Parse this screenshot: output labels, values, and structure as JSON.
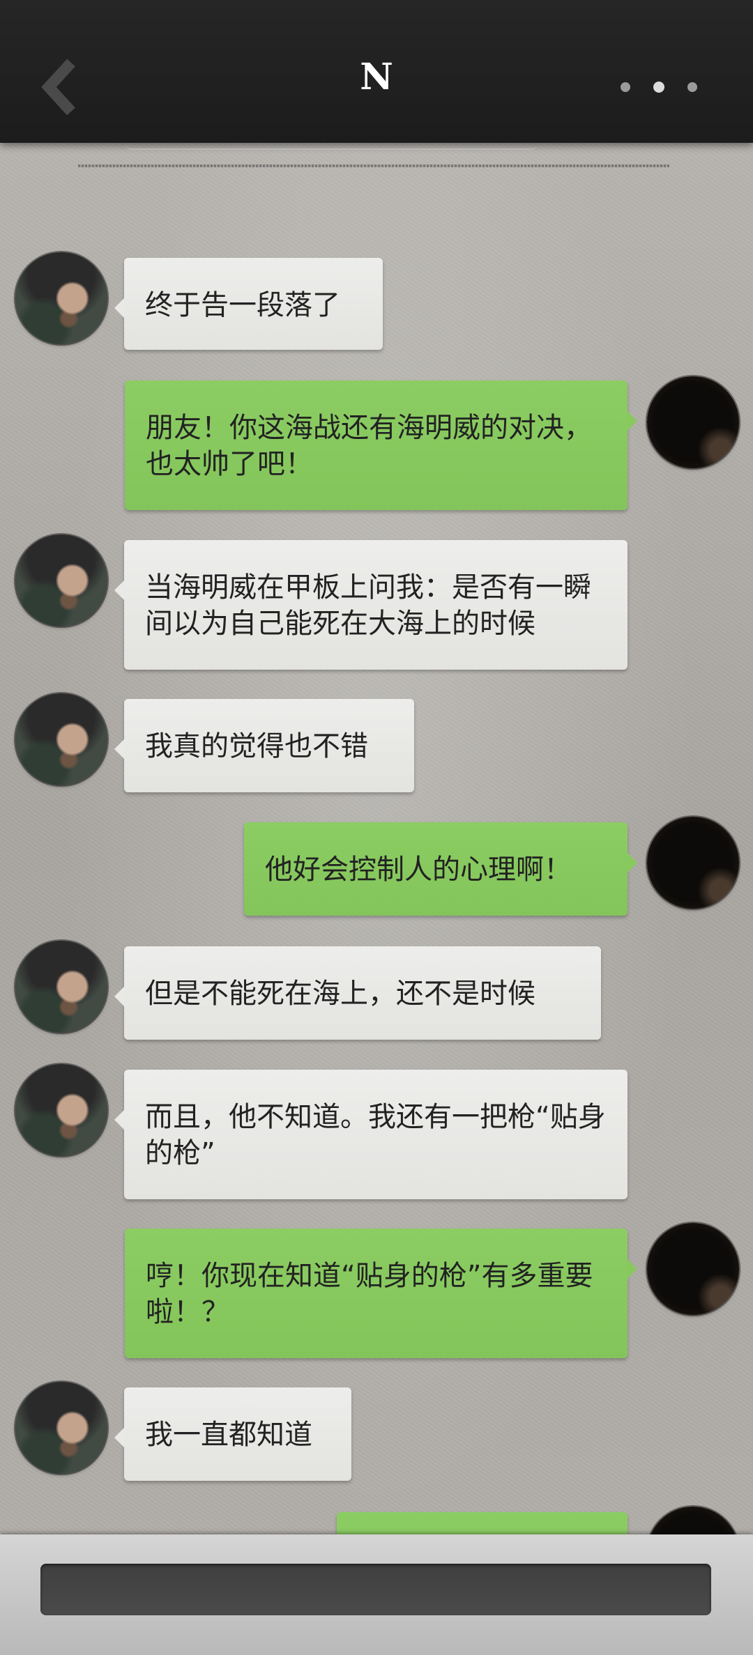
{
  "header": {
    "back_icon": "chevron-left-icon",
    "title": "N",
    "more_icon": "more-dots-icon"
  },
  "messages": [
    {
      "from": "contact",
      "text": "终于告一段落了"
    },
    {
      "from": "me",
      "text": "朋友！你这海战还有海明威的对决，也太帅了吧！"
    },
    {
      "from": "contact",
      "text": "当海明威在甲板上问我：是否有一瞬间以为自己能死在大海上的时候"
    },
    {
      "from": "contact",
      "text": "我真的觉得也不错"
    },
    {
      "from": "me",
      "text": "他好会控制人的心理啊！"
    },
    {
      "from": "contact",
      "text": "但是不能死在海上，还不是时候"
    },
    {
      "from": "contact",
      "text": "而且，他不知道。我还有一把枪“贴身的枪”"
    },
    {
      "from": "me",
      "text": "哼！你现在知道“贴身的枪”有多重要啦！？"
    },
    {
      "from": "contact",
      "text": "我一直都知道"
    },
    {
      "from": "me",
      "text": ""
    }
  ],
  "composer": {
    "placeholder": "",
    "value": ""
  },
  "colors": {
    "header_bg": "#222222",
    "outgoing_bubble": "#86c75d",
    "incoming_bubble": "#e8e8e5",
    "background": "#aeaba6",
    "input_bg": "#444444"
  }
}
